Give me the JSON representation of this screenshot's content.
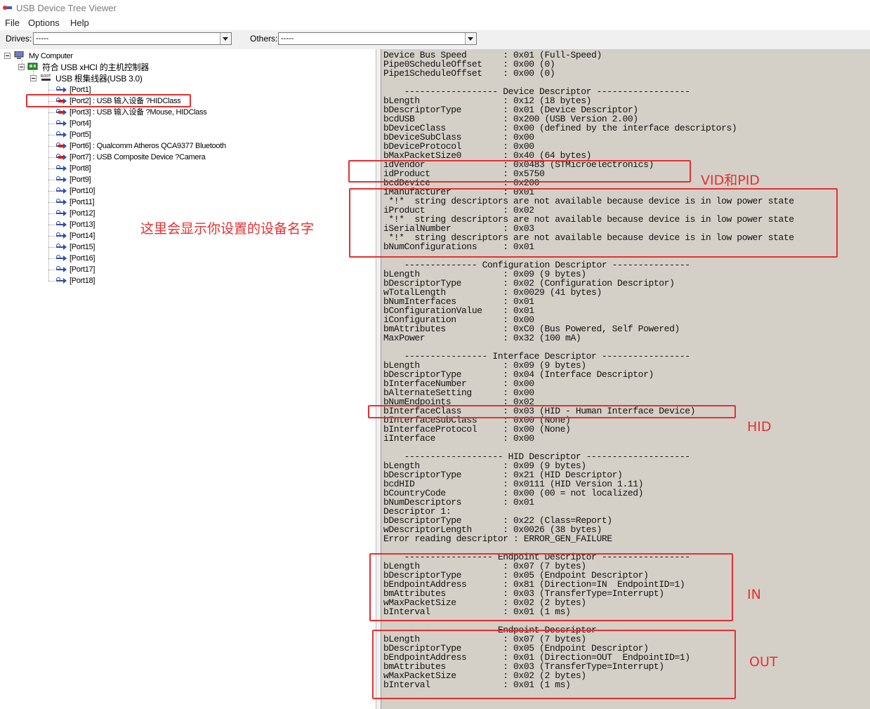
{
  "window": {
    "title": "USB Device Tree Viewer",
    "app_icon": "usb-tree-icon"
  },
  "menu": {
    "items": [
      "File",
      "Options",
      "Help"
    ]
  },
  "toolbar": {
    "drives_label": "Drives:",
    "drives_value": "-----",
    "others_label": "Others:",
    "others_value": "-----"
  },
  "tree": {
    "root": "My Computer",
    "controller": "符合 USB xHCI 的主机控制器",
    "hub": "USB 根集线器(USB 3.0)",
    "ports": [
      {
        "label": "[Port1]",
        "status": "empty"
      },
      {
        "label": "[Port2] : USB 输入设备 ?HIDClass",
        "status": "connected"
      },
      {
        "label": "[Port3] : USB 输入设备 ?Mouse, HIDClass",
        "status": "connected"
      },
      {
        "label": "[Port4]",
        "status": "empty"
      },
      {
        "label": "[Port5]",
        "status": "empty"
      },
      {
        "label": "[Port6] : Qualcomm Atheros QCA9377 Bluetooth",
        "status": "connected"
      },
      {
        "label": "[Port7] : USB Composite Device ?Camera",
        "status": "connected"
      },
      {
        "label": "[Port8]",
        "status": "empty"
      },
      {
        "label": "[Port9]",
        "status": "empty"
      },
      {
        "label": "[Port10]",
        "status": "empty"
      },
      {
        "label": "[Port11]",
        "status": "empty"
      },
      {
        "label": "[Port12]",
        "status": "empty"
      },
      {
        "label": "[Port13]",
        "status": "empty"
      },
      {
        "label": "[Port14]",
        "status": "empty"
      },
      {
        "label": "[Port15]",
        "status": "empty"
      },
      {
        "label": "[Port16]",
        "status": "empty"
      },
      {
        "label": "[Port17]",
        "status": "empty"
      },
      {
        "label": "[Port18]",
        "status": "empty"
      }
    ]
  },
  "details": {
    "lines": [
      "Device Bus Speed       : 0x01 (Full-Speed)",
      "Pipe0ScheduleOffset    : 0x00 (0)",
      "Pipe1ScheduleOffset    : 0x00 (0)",
      "",
      "    ------------------ Device Descriptor ------------------",
      "bLength                : 0x12 (18 bytes)",
      "bDescriptorType        : 0x01 (Device Descriptor)",
      "bcdUSB                 : 0x200 (USB Version 2.00)",
      "bDeviceClass           : 0x00 (defined by the interface descriptors)",
      "bDeviceSubClass        : 0x00",
      "bDeviceProtocol        : 0x00",
      "bMaxPacketSize0        : 0x40 (64 bytes)",
      "idVendor               : 0x0483 (STMicroelectronics)",
      "idProduct              : 0x5750",
      "bcdDevice              : 0x200",
      "iManufacturer          : 0x01",
      " *!*  string descriptors are not available because device is in low power state",
      "iProduct               : 0x02",
      " *!*  string descriptors are not available because device is in low power state",
      "iSerialNumber          : 0x03",
      " *!*  string descriptors are not available because device is in low power state",
      "bNumConfigurations     : 0x01",
      "",
      "    -------------- Configuration Descriptor ---------------",
      "bLength                : 0x09 (9 bytes)",
      "bDescriptorType        : 0x02 (Configuration Descriptor)",
      "wTotalLength           : 0x0029 (41 bytes)",
      "bNumInterfaces         : 0x01",
      "bConfigurationValue    : 0x01",
      "iConfiguration         : 0x00",
      "bmAttributes           : 0xC0 (Bus Powered, Self Powered)",
      "MaxPower               : 0x32 (100 mA)",
      "",
      "    ---------------- Interface Descriptor -----------------",
      "bLength                : 0x09 (9 bytes)",
      "bDescriptorType        : 0x04 (Interface Descriptor)",
      "bInterfaceNumber       : 0x00",
      "bAlternateSetting      : 0x00",
      "bNumEndpoints          : 0x02",
      "bInterfaceClass        : 0x03 (HID - Human Interface Device)",
      "bInterfaceSubClass     : 0x00 (None)",
      "bInterfaceProtocol     : 0x00 (None)",
      "iInterface             : 0x00",
      "",
      "    ------------------- HID Descriptor --------------------",
      "bLength                : 0x09 (9 bytes)",
      "bDescriptorType        : 0x21 (HID Descriptor)",
      "bcdHID                 : 0x0111 (HID Version 1.11)",
      "bCountryCode           : 0x00 (00 = not localized)",
      "bNumDescriptors        : 0x01",
      "Descriptor 1:",
      "bDescriptorType        : 0x22 (Class=Report)",
      "wDescriptorLength      : 0x0026 (38 bytes)",
      "Error reading descriptor : ERROR_GEN_FAILURE",
      "",
      "    ----------------- Endpoint Descriptor -----------------",
      "bLength                : 0x07 (7 bytes)",
      "bDescriptorType        : 0x05 (Endpoint Descriptor)",
      "bEndpointAddress       : 0x81 (Direction=IN  EndpointID=1)",
      "bmAttributes           : 0x03 (TransferType=Interrupt)",
      "wMaxPacketSize         : 0x02 (2 bytes)",
      "bInterval              : 0x01 (1 ms)",
      "",
      "    ----------------- Endpoint Descriptor -----------------",
      "bLength                : 0x07 (7 bytes)",
      "bDescriptorType        : 0x05 (Endpoint Descriptor)",
      "bEndpointAddress       : 0x01 (Direction=OUT  EndpointID=1)",
      "bmAttributes           : 0x03 (TransferType=Interrupt)",
      "wMaxPacketSize         : 0x02 (2 bytes)",
      "bInterval              : 0x01 (1 ms)"
    ]
  },
  "annotations": {
    "device_name_note": "这里会显示你设置的设备名字",
    "vid_pid": "VID和PID",
    "hid": "HID",
    "in": "IN",
    "out": "OUT",
    "color": "#e53030"
  }
}
